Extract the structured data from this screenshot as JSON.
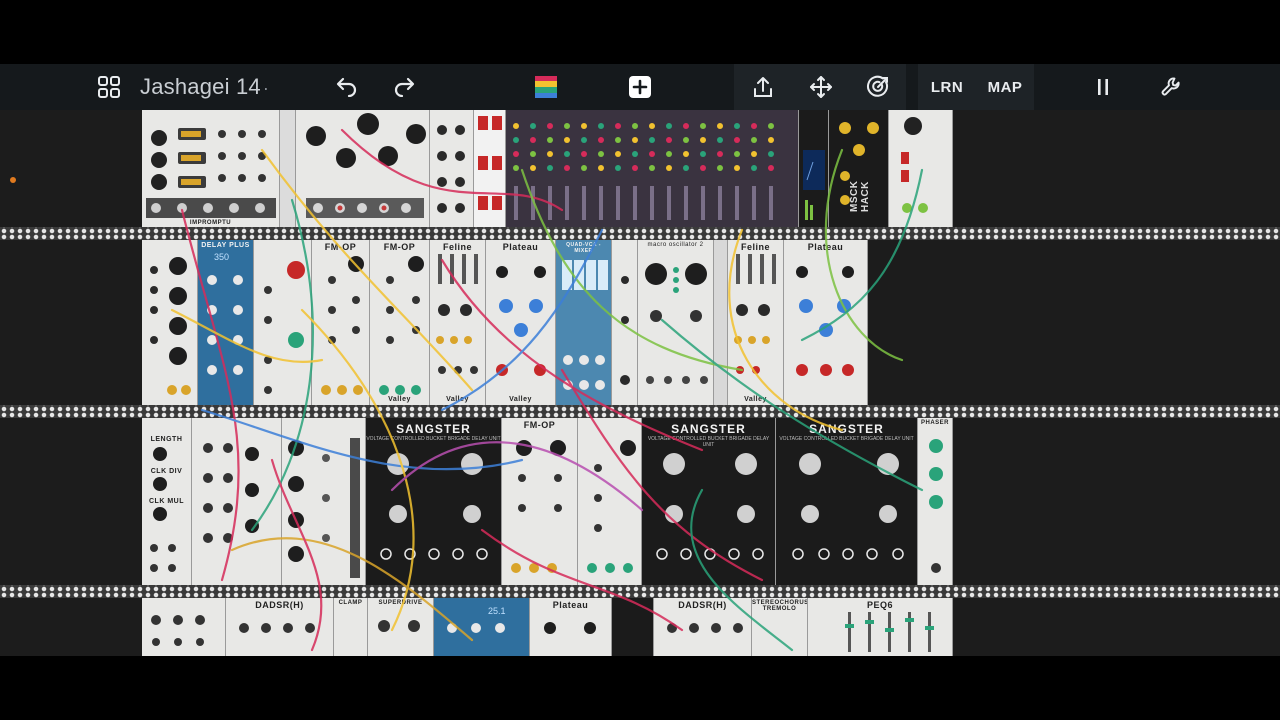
{
  "toolbar": {
    "patch_title": "Jashagei 14",
    "unsaved_marker": "·",
    "learn_label": "LRN",
    "map_label": "MAP",
    "icons": {
      "browser": "grid-icon",
      "undo": "undo-icon",
      "redo": "redo-icon",
      "colors": "cable-colors-icon",
      "add": "add-module-icon",
      "export": "share-icon",
      "move": "move-icon",
      "target": "target-icon",
      "pause": "pause-icon",
      "settings": "wrench-icon"
    }
  },
  "modules": {
    "impromptu": "IMPROMPTU",
    "msck_hack": "MSCK HACK",
    "feline_1": "Feline",
    "plateau_1": "Plateau",
    "quad_vca_mixer": "QUAD-VCA - MIXER",
    "oscillator_2": "macro oscillator 2",
    "feline_2": "Feline",
    "plateau_2": "Plateau",
    "fm_op_1": "FM-OP",
    "fm_op_2": "FM-OP",
    "delayplus": "DELAY PLUS",
    "delay_time": "350",
    "valley_1": "Valley",
    "valley_2": "Valley",
    "valley_3": "Valley",
    "valley_4": "Valley",
    "gangster_1": "SANGSTER",
    "gangster_2": "SANGSTER",
    "gangster_3": "SANGSTER",
    "gangster_sub": "VOLTAGE CONTROLLED BUCKET BRIGADE DELAY UNIT",
    "phaser": "PHASER",
    "dadsr_1": "DADSR(H)",
    "dadsr_2": "DADSR(H)",
    "plateau_3": "Plateau",
    "clamp": "CLAMP",
    "superdrive": "SUPERDRIVE",
    "delay_val": "25.1",
    "stereochorus": "STEREOCHORUS TREMOLO",
    "peq6": "PEQ6",
    "fm_op_3": "FM-OP",
    "length": "LENGTH",
    "clk_div": "CLK DIV",
    "clk_mul": "CLK MUL"
  },
  "colors": {
    "toolbar_bg": "#15191c",
    "segment_bg": "#1e2327",
    "panel_light": "#e8e8e6",
    "panel_blue": "#2f6f9e",
    "panel_dark": "#1b1b1b",
    "cable_colors": [
      "#d62b5a",
      "#f2c230",
      "#2aa37a",
      "#3c7fd8",
      "#7dc242",
      "#d9a42a",
      "#b84fb0"
    ]
  }
}
